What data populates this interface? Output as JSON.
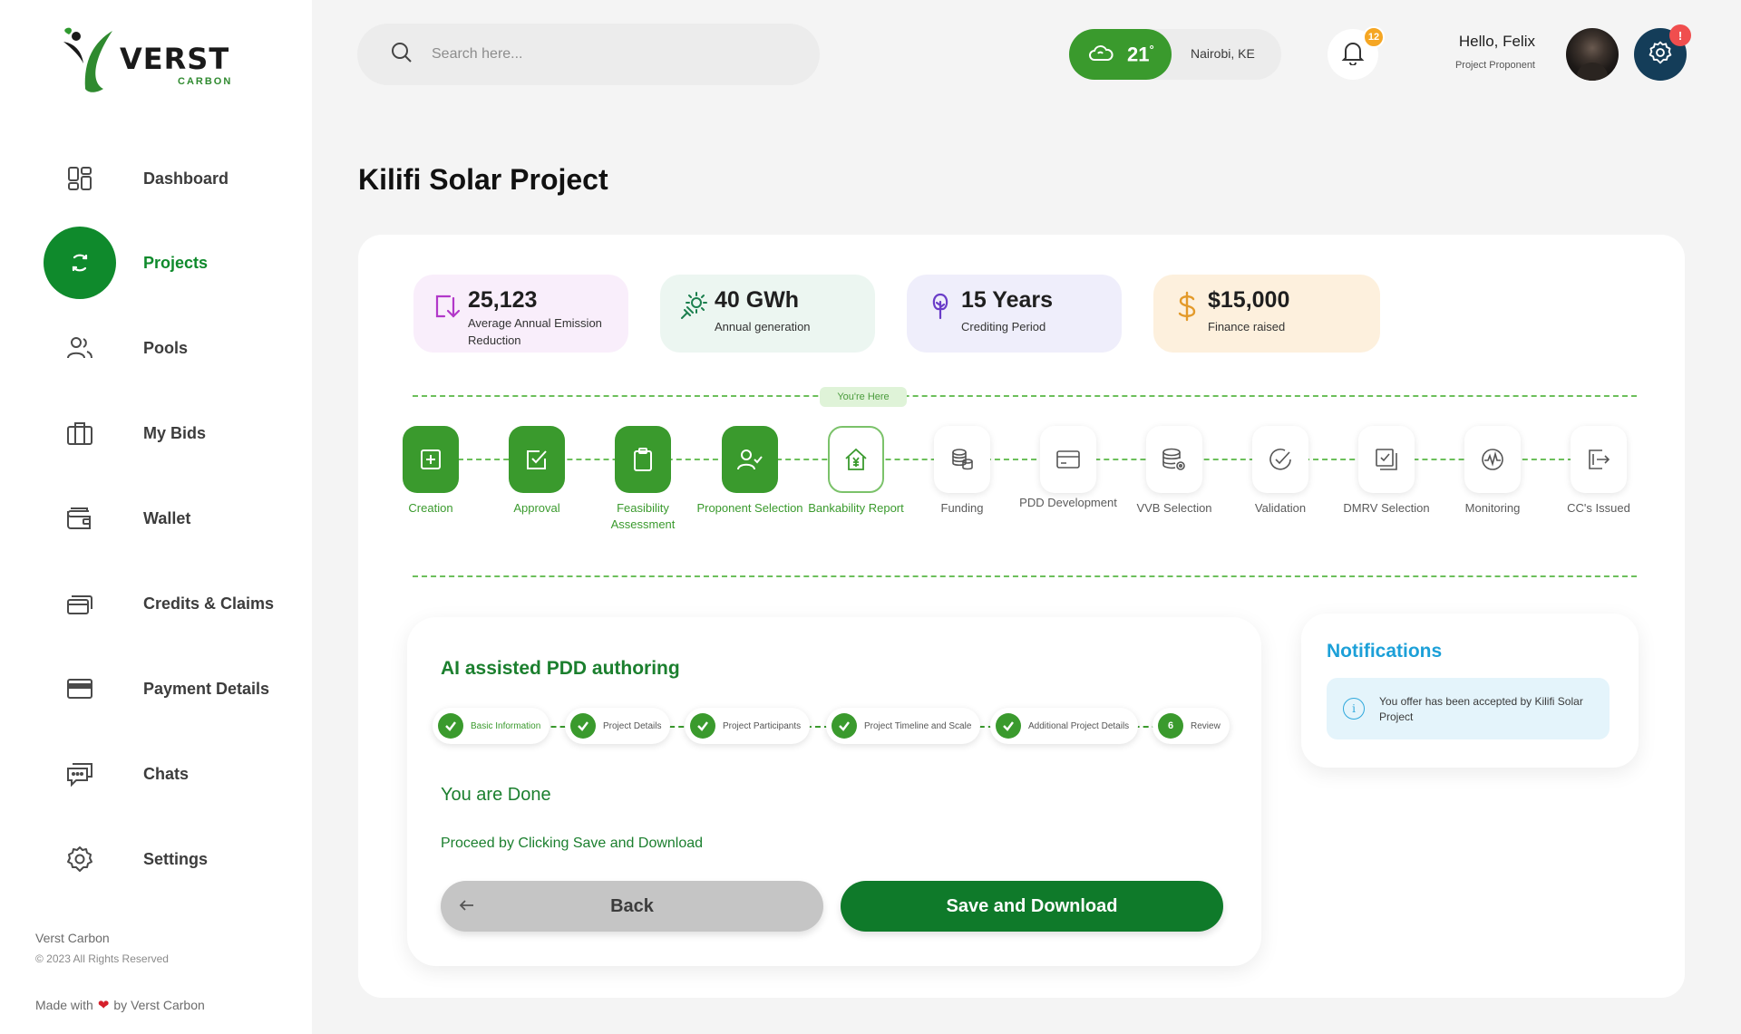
{
  "brand": {
    "name": "VERST",
    "sub": "CARBON"
  },
  "sidebar": {
    "items": [
      {
        "label": "Dashboard",
        "icon": "dashboard-icon"
      },
      {
        "label": "Projects",
        "icon": "refresh-icon",
        "active": true
      },
      {
        "label": "Pools",
        "icon": "users-icon"
      },
      {
        "label": "My Bids",
        "icon": "briefcase-icon"
      },
      {
        "label": "Wallet",
        "icon": "wallet-icon"
      },
      {
        "label": "Credits & Claims",
        "icon": "cards-icon"
      },
      {
        "label": "Payment Details",
        "icon": "credit-card-icon"
      },
      {
        "label": "Chats",
        "icon": "chat-icon"
      },
      {
        "label": "Settings",
        "icon": "gear-icon"
      }
    ],
    "footer": {
      "brand": "Verst Carbon",
      "copyright": "© 2023 All Rights Reserved",
      "made_prefix": "Made with",
      "made_suffix": "by Verst Carbon"
    }
  },
  "header": {
    "search_placeholder": "Search here...",
    "weather": {
      "temp": "21",
      "unit": "°",
      "city": "Nairobi, KE"
    },
    "notifications_count": "12",
    "greeting": "Hello, Felix",
    "role": "Project Proponent",
    "settings_alert": "!"
  },
  "page": {
    "title": "Kilifi Solar Project"
  },
  "stats": [
    {
      "value": "25,123",
      "label": "Average Annual Emission Reduction",
      "icon": "arrow-down-box-icon",
      "color": "#b238c9"
    },
    {
      "value": "40 GWh",
      "label": "Annual generation",
      "icon": "solar-plug-icon",
      "color": "#1b7f4e"
    },
    {
      "value": "15 Years",
      "label": "Crediting Period",
      "icon": "tree-icon",
      "color": "#6a3dc8"
    },
    {
      "value": "$15,000",
      "label": "Finance raised",
      "icon": "dollar-icon",
      "color": "#e39a2a"
    }
  ],
  "progress": {
    "you_are_here": "You're Here",
    "steps": [
      {
        "label": "Creation",
        "state": "done",
        "icon": "plus-square-icon"
      },
      {
        "label": "Approval",
        "state": "done",
        "icon": "check-square-icon"
      },
      {
        "label": "Feasibility Assessment",
        "state": "done",
        "icon": "clipboard-icon"
      },
      {
        "label": "Proponent Selection",
        "state": "done",
        "icon": "user-check-icon"
      },
      {
        "label": "Bankability Report",
        "state": "current",
        "icon": "house-yen-icon"
      },
      {
        "label": "Funding",
        "state": "todo",
        "icon": "coins-icon"
      },
      {
        "label": "PDD Development",
        "state": "todo",
        "icon": "card-icon"
      },
      {
        "label": "VVB Selection",
        "state": "todo",
        "icon": "database-gear-icon"
      },
      {
        "label": "Validation",
        "state": "todo",
        "icon": "check-circle-icon"
      },
      {
        "label": "DMRV Selection",
        "state": "todo",
        "icon": "stack-check-icon"
      },
      {
        "label": "Monitoring",
        "state": "todo",
        "icon": "pulse-icon"
      },
      {
        "label": "CC's Issued",
        "state": "todo",
        "icon": "export-icon"
      }
    ]
  },
  "pdd": {
    "title": "AI assisted PDD authoring",
    "substeps": [
      {
        "label": "Basic Information",
        "mark": ""
      },
      {
        "label": "Project Details",
        "mark": ""
      },
      {
        "label": "Project Participants",
        "mark": ""
      },
      {
        "label": "Project Timeline and Scale",
        "mark": ""
      },
      {
        "label": "Additional Project Details",
        "mark": ""
      },
      {
        "label": "Review",
        "mark": "6"
      }
    ],
    "done_title": "You are Done",
    "done_sub": "Proceed by Clicking Save and Download",
    "back_label": "Back",
    "save_label": "Save and Download"
  },
  "notifications": {
    "title": "Notifications",
    "items": [
      {
        "text": "You offer has been accepted by Kilifi Solar Project",
        "icon": "info-icon"
      }
    ]
  },
  "colors": {
    "primary_green": "#0f8a2c",
    "step_green": "#3a9a2d",
    "notif_blue": "#1ca0d8",
    "settings_navy": "#143d59"
  }
}
